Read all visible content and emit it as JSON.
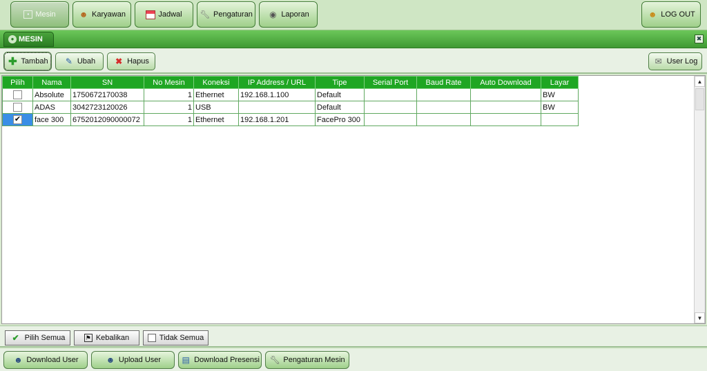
{
  "topnav": {
    "items": [
      {
        "label": "Mesin",
        "icon": "machine-icon"
      },
      {
        "label": "Karyawan",
        "icon": "employees-icon"
      },
      {
        "label": "Jadwal",
        "icon": "calendar-icon"
      },
      {
        "label": "Pengaturan",
        "icon": "wrench-icon"
      },
      {
        "label": "Laporan",
        "icon": "report-icon"
      }
    ],
    "logout_label": "LOG OUT"
  },
  "tab": {
    "label": "MESIN"
  },
  "toolbar": {
    "add_label": "Tambah",
    "edit_label": "Ubah",
    "delete_label": "Hapus",
    "userlog_label": "User Log"
  },
  "grid": {
    "headers": [
      "Pilih",
      "Nama",
      "SN",
      "No Mesin",
      "Koneksi",
      "IP Address / URL",
      "Tipe",
      "Serial Port",
      "Baud Rate",
      "Auto Download",
      "Layar"
    ],
    "rows": [
      {
        "selected": false,
        "nama": "Absolute",
        "sn": "1750672170038",
        "no_mesin": "1",
        "koneksi": "Ethernet",
        "ip": "192.168.1.100",
        "tipe": "Default",
        "serial": "",
        "baud": "",
        "auto": "",
        "layar": "BW"
      },
      {
        "selected": false,
        "nama": "ADAS",
        "sn": "3042723120026",
        "no_mesin": "1",
        "koneksi": "USB",
        "ip": "",
        "tipe": "Default",
        "serial": "",
        "baud": "",
        "auto": "",
        "layar": "BW"
      },
      {
        "selected": true,
        "nama": "face 300",
        "sn": "6752012090000072",
        "no_mesin": "1",
        "koneksi": "Ethernet",
        "ip": "192.168.1.201",
        "tipe": "FacePro 300",
        "serial": "",
        "baud": "",
        "auto": "",
        "layar": ""
      }
    ]
  },
  "selection": {
    "select_all_label": "Pilih Semua",
    "invert_label": "Kebalikan",
    "none_label": "Tidak Semua"
  },
  "actions": {
    "download_user_label": "Download User",
    "upload_user_label": "Upload User",
    "download_attendance_label": "Download Presensi",
    "machine_settings_label": "Pengaturan Mesin"
  },
  "icons": {
    "checkmark": "✔",
    "close": "✖"
  },
  "colors": {
    "header_green": "#1fa623",
    "tab_green": "#3f9a33",
    "selection_blue": "#3a8ee6"
  }
}
